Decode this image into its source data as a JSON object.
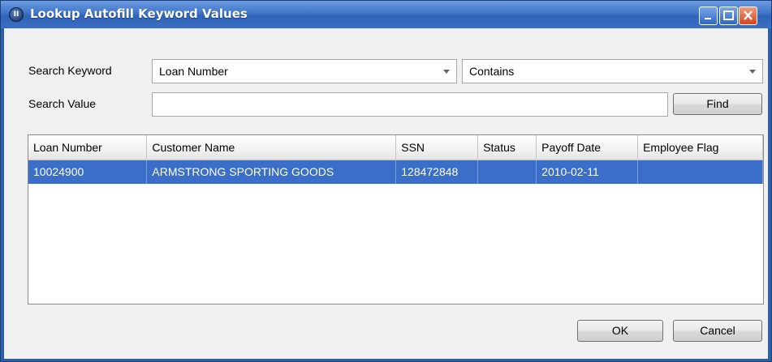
{
  "window": {
    "title": "Lookup Autofill Keyword Values",
    "icon_text": "II"
  },
  "form": {
    "search_keyword_label": "Search Keyword",
    "search_value_label": "Search Value",
    "keyword_selected": "Loan Number",
    "operator_selected": "Contains",
    "search_value": "",
    "find_label": "Find"
  },
  "table": {
    "columns": [
      "Loan Number",
      "Customer Name",
      "SSN",
      "Status",
      "Payoff Date",
      "Employee Flag"
    ],
    "rows": [
      [
        "10024900",
        "ARMSTRONG SPORTING GOODS",
        "128472848",
        "",
        "2010-02-11",
        ""
      ]
    ],
    "selected_row": 0
  },
  "footer": {
    "ok_label": "OK",
    "cancel_label": "Cancel"
  },
  "colors": {
    "titlebar": "#3f74c8",
    "selection": "#3a6ec8",
    "dialog_bg": "#f0f0f0"
  }
}
